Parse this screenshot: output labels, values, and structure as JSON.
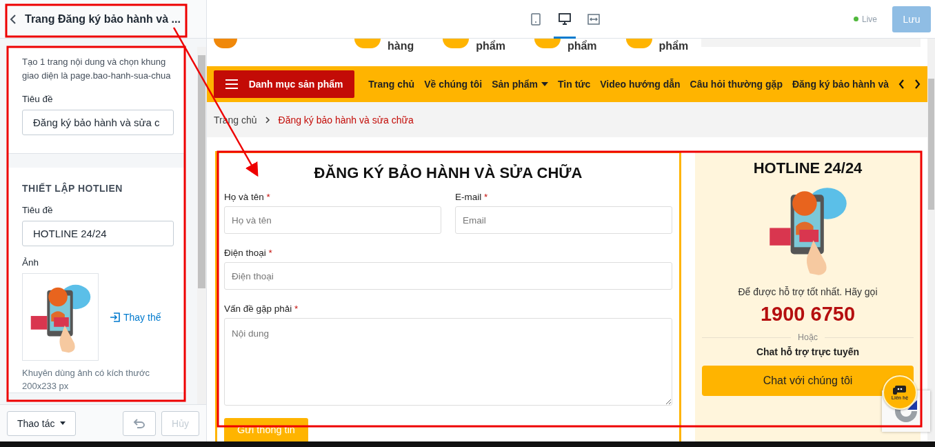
{
  "editor": {
    "back_title": "Trang Đăng ký bảo hành và ...",
    "intro": "Tạo 1 trang nội dung và chọn khung giao diện là page.bao-hanh-sua-chua",
    "title_label": "Tiêu đề",
    "title_value": "Đăng ký bảo hành và sửa c",
    "hotline_heading": "THIẾT LẬP HOTLIEN",
    "hotline_title_label": "Tiêu đề",
    "hotline_title_value": "HOTLINE 24/24",
    "image_label": "Ảnh",
    "replace_link": "Thay thế",
    "image_hint": "Khuyên dùng ảnh có kích thước 200x233 px"
  },
  "footer": {
    "actions_label": "Thao tác",
    "undo": {
      "disabled": true
    },
    "cancel": {
      "label": "Hủy",
      "disabled": true
    }
  },
  "topbar": {
    "devices": [
      {
        "kind": "mobile",
        "selected": false
      },
      {
        "kind": "desktop",
        "selected": true
      },
      {
        "kind": "fullwidth",
        "selected": false
      }
    ],
    "live": {
      "label": "Live",
      "on": true
    },
    "save": {
      "label": "Lưu",
      "disabled": true
    }
  },
  "site": {
    "shortcuts": [
      "hàng",
      "phẩm",
      "phẩm",
      "phẩm"
    ],
    "category_button": "Danh mục sản phẩm",
    "menu": [
      {
        "label": "Trang chủ",
        "has_dropdown": false
      },
      {
        "label": "Về chúng tôi",
        "has_dropdown": false
      },
      {
        "label": "Sản phẩm",
        "has_dropdown": true
      },
      {
        "label": "Tin tức",
        "has_dropdown": false
      },
      {
        "label": "Video hướng dẫn",
        "has_dropdown": false
      },
      {
        "label": "Câu hỏi thường gặp",
        "has_dropdown": false
      },
      {
        "label": "Đăng ký bảo hành và",
        "has_dropdown": false
      }
    ],
    "breadcrumb": [
      {
        "label": "Trang chủ",
        "selected": false
      },
      {
        "label": "Đăng ký bảo hành và sửa chữa",
        "selected": true
      }
    ]
  },
  "form": {
    "title": "ĐĂNG KÝ BẢO HÀNH VÀ SỬA CHỮA",
    "required_mark": "*",
    "rows": [
      [
        {
          "kind": "text",
          "label": "Họ và tên",
          "required": true,
          "placeholder": "Họ và tên"
        },
        {
          "kind": "text",
          "label": "E-mail",
          "required": true,
          "placeholder": "Email"
        }
      ],
      [
        {
          "kind": "text",
          "label": "Điện thoại",
          "required": true,
          "placeholder": "Điện thoại"
        }
      ],
      [
        {
          "kind": "textarea",
          "label": "Vấn đề gặp phải",
          "required": true,
          "placeholder": "Nội dung"
        }
      ]
    ],
    "submit": "Gửi thông tin"
  },
  "hotline": {
    "title": "HOTLINE 24/24",
    "text": "Để được hỗ trợ tốt nhất. Hãy gọi",
    "phone": "1900 6750",
    "divider": "Hoặc",
    "chat_title": "Chat hỗ trợ trực tuyến",
    "chat_button": "Chat với chúng tôi"
  },
  "contact_badge": "Liên hệ"
}
